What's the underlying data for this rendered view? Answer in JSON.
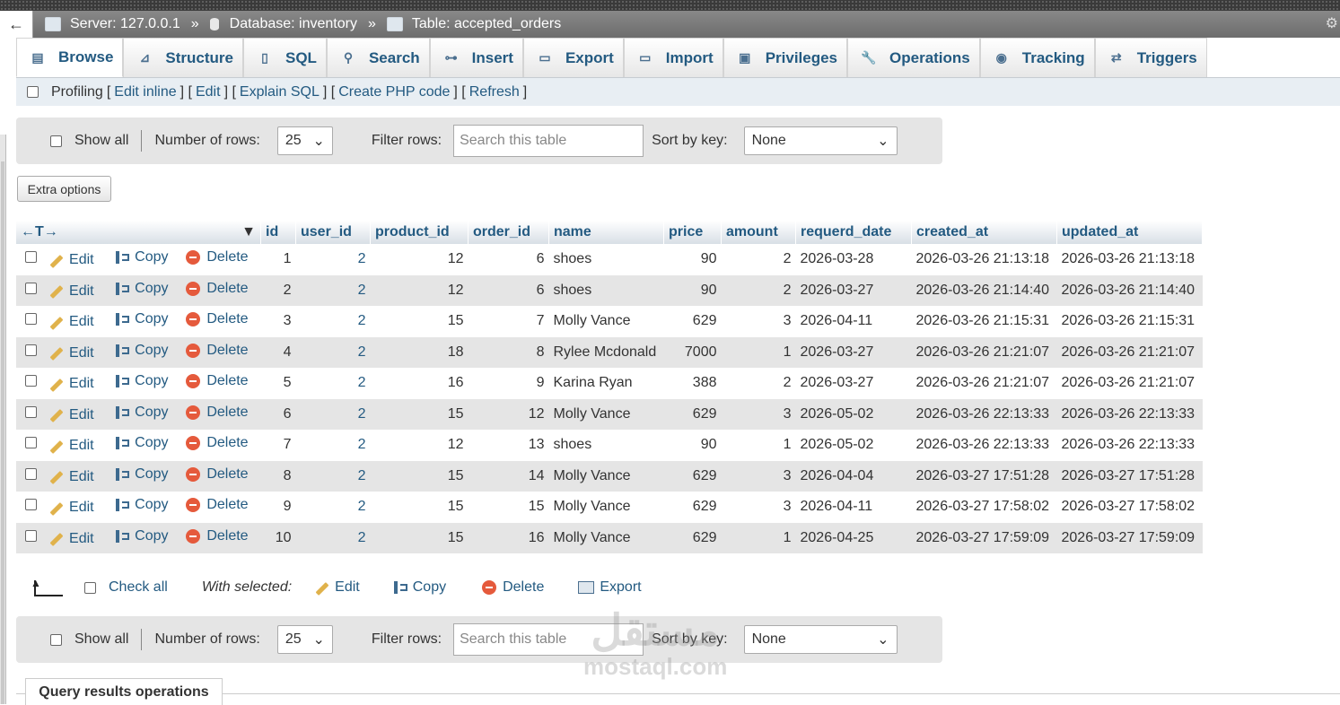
{
  "breadcrumb": {
    "back": "←",
    "server": "Server: 127.0.0.1",
    "database": "Database: inventory",
    "table": "Table: accepted_orders",
    "separator": "»"
  },
  "tabs": [
    {
      "label": "Browse",
      "icon": "browse-icon",
      "active": true
    },
    {
      "label": "Structure",
      "icon": "structure-icon"
    },
    {
      "label": "SQL",
      "icon": "sql-icon"
    },
    {
      "label": "Search",
      "icon": "search-icon"
    },
    {
      "label": "Insert",
      "icon": "insert-icon"
    },
    {
      "label": "Export",
      "icon": "export-icon"
    },
    {
      "label": "Import",
      "icon": "import-icon"
    },
    {
      "label": "Privileges",
      "icon": "privileges-icon"
    },
    {
      "label": "Operations",
      "icon": "wrench-icon"
    },
    {
      "label": "Tracking",
      "icon": "eye-icon"
    },
    {
      "label": "Triggers",
      "icon": "triggers-icon"
    }
  ],
  "profiling": {
    "label": "Profiling",
    "links": [
      "Edit inline",
      "Edit",
      "Explain SQL",
      "Create PHP code",
      "Refresh"
    ],
    "open": "[",
    "close": "]",
    "mid": "] ["
  },
  "nav": {
    "show_all": "Show all",
    "rows_label": "Number of rows:",
    "rows_value": "25",
    "filter_label": "Filter rows:",
    "filter_placeholder": "Search this table",
    "sort_label": "Sort by key:",
    "sort_value": "None"
  },
  "extra_options": "Extra options",
  "table": {
    "col_controls": "←T→",
    "columns": [
      "id",
      "user_id",
      "product_id",
      "order_id",
      "name",
      "price",
      "amount",
      "requerd_date",
      "created_at",
      "updated_at"
    ],
    "actions": {
      "edit": "Edit",
      "copy": "Copy",
      "delete": "Delete"
    },
    "rows": [
      [
        "1",
        "2",
        "12",
        "6",
        "shoes",
        "90",
        "2",
        "2026-03-28",
        "2026-03-26 21:13:18",
        "2026-03-26 21:13:18"
      ],
      [
        "2",
        "2",
        "12",
        "6",
        "shoes",
        "90",
        "2",
        "2026-03-27",
        "2026-03-26 21:14:40",
        "2026-03-26 21:14:40"
      ],
      [
        "3",
        "2",
        "15",
        "7",
        "Molly Vance",
        "629",
        "3",
        "2026-04-11",
        "2026-03-26 21:15:31",
        "2026-03-26 21:15:31"
      ],
      [
        "4",
        "2",
        "18",
        "8",
        "Rylee Mcdonald",
        "7000",
        "1",
        "2026-03-27",
        "2026-03-26 21:21:07",
        "2026-03-26 21:21:07"
      ],
      [
        "5",
        "2",
        "16",
        "9",
        "Karina Ryan",
        "388",
        "2",
        "2026-03-27",
        "2026-03-26 21:21:07",
        "2026-03-26 21:21:07"
      ],
      [
        "6",
        "2",
        "15",
        "12",
        "Molly Vance",
        "629",
        "3",
        "2026-05-02",
        "2026-03-26 22:13:33",
        "2026-03-26 22:13:33"
      ],
      [
        "7",
        "2",
        "12",
        "13",
        "shoes",
        "90",
        "1",
        "2026-05-02",
        "2026-03-26 22:13:33",
        "2026-03-26 22:13:33"
      ],
      [
        "8",
        "2",
        "15",
        "14",
        "Molly Vance",
        "629",
        "3",
        "2026-04-04",
        "2026-03-27 17:51:28",
        "2026-03-27 17:51:28"
      ],
      [
        "9",
        "2",
        "15",
        "15",
        "Molly Vance",
        "629",
        "3",
        "2026-04-11",
        "2026-03-27 17:58:02",
        "2026-03-27 17:58:02"
      ],
      [
        "10",
        "2",
        "15",
        "16",
        "Molly Vance",
        "629",
        "1",
        "2026-04-25",
        "2026-03-27 17:59:09",
        "2026-03-27 17:59:09"
      ]
    ]
  },
  "bulk": {
    "check_all": "Check all",
    "with_selected": "With selected:",
    "edit": "Edit",
    "copy": "Copy",
    "delete": "Delete",
    "export": "Export"
  },
  "watermark": {
    "arabic": "مستقل",
    "latin": "mostaql.com"
  },
  "query_ops_tab": "Query results operations"
}
